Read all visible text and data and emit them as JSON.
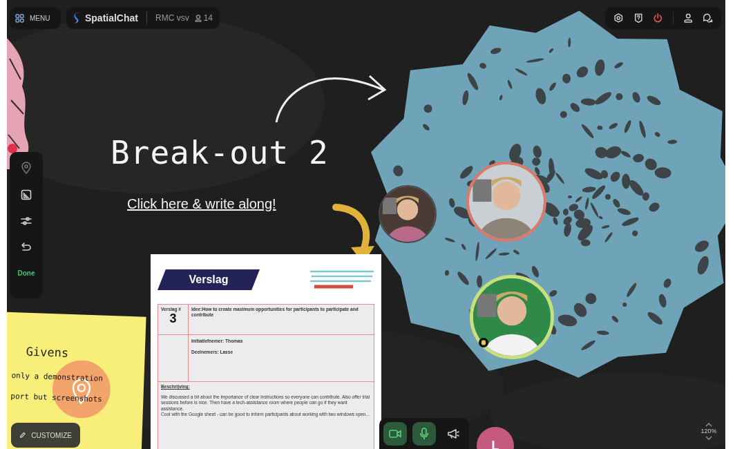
{
  "topbar": {
    "menu_label": "MENU",
    "brand": "SpatialChat",
    "room": "RMC vsv",
    "participant_count": "14"
  },
  "toolbar": {
    "done_label": "Done"
  },
  "board": {
    "title": "Break-out 2",
    "link": "Click here & write along!"
  },
  "document": {
    "title": "Verslag",
    "number_label": "Verslag #",
    "number": "3",
    "idea": "Idee:How to create maximum opportunities for participants to participate and contribute",
    "initiator": "Initiatiefnemer: Thomas",
    "participants": "Deelnemers: Lasse",
    "description_label": "Beschrijving:",
    "description": [
      "We discussed a bit about the importance of clear instructions so everyone can contribute. Also offer trial sessions before is nice. Then have a tech-assistance room where people can go if they want assistance.",
      "Cool with the Google sheet - can be good to inform participants about working with two windows open..."
    ]
  },
  "sticky_note": {
    "title": "Givens",
    "lines": [
      "only a demonstration",
      "port but screenshots"
    ]
  },
  "participants": [
    {
      "color": "#4a4a4a"
    },
    {
      "color": "#e0786a"
    },
    {
      "color": "#c8e07a"
    }
  ],
  "customize_label": "CUSTOMIZE",
  "media": {
    "camera_on": true,
    "mic_on": true
  },
  "avatar": {
    "initial": "L"
  },
  "zoom": "120%"
}
